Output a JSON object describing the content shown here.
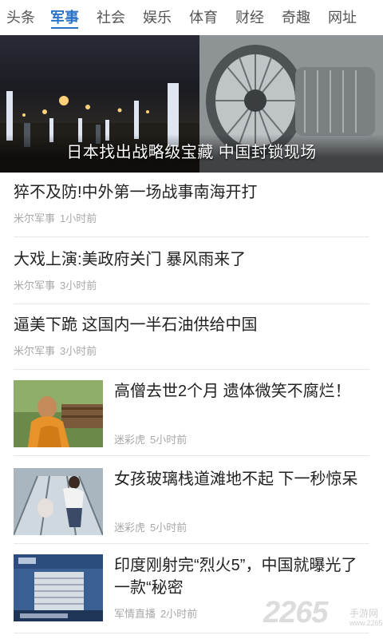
{
  "tabs": [
    "头条",
    "军事",
    "社会",
    "娱乐",
    "体育",
    "财经",
    "奇趣",
    "网址"
  ],
  "active_tab_index": 1,
  "hero": {
    "title": "日本找出战略级宝藏 中国封锁现场",
    "dots_count": 3,
    "active_dot_index": 2
  },
  "news": [
    {
      "title": "猝不及防!中外第一场战事南海开打",
      "source": "米尔军事",
      "time": "1小时前"
    },
    {
      "title": "大戏上演:美政府关门 暴风雨来了",
      "source": "米尔军事",
      "time": "3小时前"
    },
    {
      "title": "逼美下跪 这国内一半石油供给中国",
      "source": "米尔军事",
      "time": "3小时前"
    },
    {
      "title": "高僧去世2个月 遗体微笑不腐烂！",
      "source": "迷彩虎",
      "time": "5小时前",
      "thumb": "monk-photo"
    },
    {
      "title": "女孩玻璃栈道滩地不起 下一秒惊呆",
      "source": "迷彩虎",
      "time": "5小时前",
      "thumb": "glass-walkway-photo"
    },
    {
      "title": "印度刚射完“烈火5”，中国就曝光了一款“秘密",
      "source": "军情直播",
      "time": "2小时前",
      "thumb": "tv-news-photo"
    }
  ],
  "watermark": {
    "number": "2265",
    "suffix": ".com",
    "text": "手游网",
    "url": "www.2265.com"
  },
  "colors": {
    "accent": "#2b73c8",
    "meta": "#a8a8a8",
    "divider": "#e6e6e6"
  }
}
